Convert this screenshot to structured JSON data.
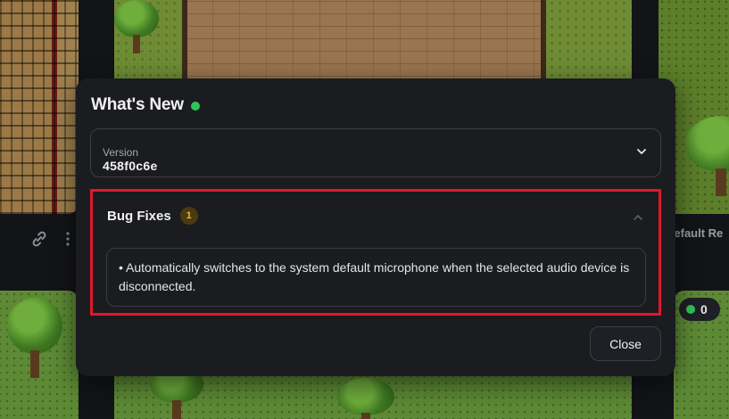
{
  "background": {
    "right_game_title": "Default Re",
    "player_count": "0",
    "icons": [
      "link-icon",
      "kebab-menu-icon"
    ]
  },
  "modal": {
    "title": "What's New",
    "status_color": "#2fc45a",
    "version": {
      "label": "Version",
      "value": "458f0c6e"
    },
    "sections": [
      {
        "title": "Bug Fixes",
        "count": "1",
        "items": [
          "• Automatically switches to the system default microphone when the selected audio device is disconnected."
        ]
      }
    ],
    "close_label": "Close"
  },
  "colors": {
    "highlight_border": "#e0172d",
    "modal_bg": "#1b1c20",
    "badge_text": "#e9b43a"
  }
}
